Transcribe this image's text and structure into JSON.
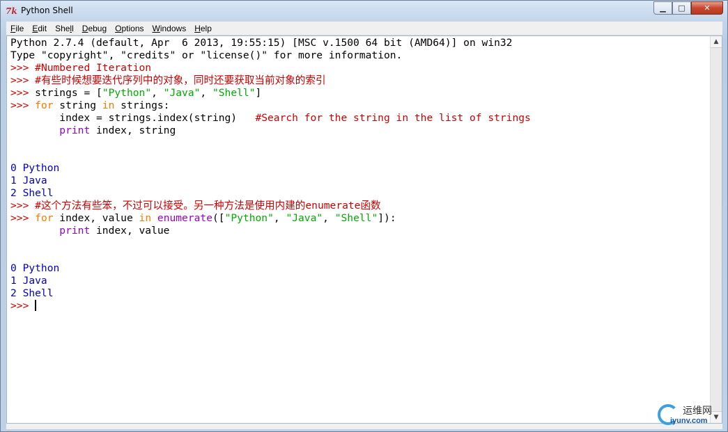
{
  "window": {
    "title": "Python Shell",
    "app_icon_text": "7k",
    "minimize_glyph": "▁",
    "maximize_glyph": "□",
    "close_glyph": "✕"
  },
  "menu": [
    {
      "label": "File",
      "ul": "F",
      "rest": "ile"
    },
    {
      "label": "Edit",
      "ul": "E",
      "rest": "dit"
    },
    {
      "label": "Shell",
      "pre": "She",
      "ul": "l",
      "rest": "l"
    },
    {
      "label": "Debug",
      "ul": "D",
      "rest": "ebug"
    },
    {
      "label": "Options",
      "ul": "O",
      "rest": "ptions"
    },
    {
      "label": "Windows",
      "ul": "W",
      "rest": "indows"
    },
    {
      "label": "Help",
      "ul": "H",
      "rest": "elp"
    }
  ],
  "lines": [
    [
      [
        "blk",
        "Python 2.7.4 (default, Apr  6 2013, 19:55:15) [MSC v.1500 64 bit (AMD64)] on win32"
      ]
    ],
    [
      [
        "blk",
        "Type \"copyright\", \"credits\" or \"license()\" for more information."
      ]
    ],
    [
      [
        "red",
        ">>> "
      ],
      [
        "red",
        "#Numbered Iteration"
      ]
    ],
    [
      [
        "red",
        ">>> "
      ],
      [
        "red",
        "#有些时候想要迭代序列中的对象，同时还要获取当前对象的索引"
      ]
    ],
    [
      [
        "red",
        ">>> "
      ],
      [
        "blk",
        "strings = ["
      ],
      [
        "green",
        "\"Python\""
      ],
      [
        "blk",
        ", "
      ],
      [
        "green",
        "\"Java\""
      ],
      [
        "blk",
        ", "
      ],
      [
        "green",
        "\"Shell\""
      ],
      [
        "blk",
        "]"
      ]
    ],
    [
      [
        "red",
        ">>> "
      ],
      [
        "orange",
        "for"
      ],
      [
        "blk",
        " string "
      ],
      [
        "orange",
        "in"
      ],
      [
        "blk",
        " strings:"
      ]
    ],
    [
      [
        "blk",
        "        index = strings.index(string)   "
      ],
      [
        "red",
        "#Search for the string in the list of strings"
      ]
    ],
    [
      [
        "blk",
        "        "
      ],
      [
        "purple",
        "print"
      ],
      [
        "blk",
        " index, string"
      ]
    ],
    [
      [
        "blk",
        ""
      ]
    ],
    [
      [
        "blk",
        ""
      ]
    ],
    [
      [
        "blue",
        "0 Python"
      ]
    ],
    [
      [
        "blue",
        "1 Java"
      ]
    ],
    [
      [
        "blue",
        "2 Shell"
      ]
    ],
    [
      [
        "red",
        ">>> "
      ],
      [
        "red",
        "#这个方法有些笨，不过可以接受。另一种方法是使用内建的enumerate函数"
      ]
    ],
    [
      [
        "red",
        ">>> "
      ],
      [
        "orange",
        "for"
      ],
      [
        "blk",
        " index, value "
      ],
      [
        "orange",
        "in"
      ],
      [
        "blk",
        " "
      ],
      [
        "purple",
        "enumerate"
      ],
      [
        "blk",
        "(["
      ],
      [
        "green",
        "\"Python\""
      ],
      [
        "blk",
        ", "
      ],
      [
        "green",
        "\"Java\""
      ],
      [
        "blk",
        ", "
      ],
      [
        "green",
        "\"Shell\""
      ],
      [
        "blk",
        "]):"
      ]
    ],
    [
      [
        "blk",
        "        "
      ],
      [
        "purple",
        "print"
      ],
      [
        "blk",
        " index, value"
      ]
    ],
    [
      [
        "blk",
        ""
      ]
    ],
    [
      [
        "blk",
        ""
      ]
    ],
    [
      [
        "blue",
        "0 Python"
      ]
    ],
    [
      [
        "blue",
        "1 Java"
      ]
    ],
    [
      [
        "blue",
        "2 Shell"
      ]
    ],
    [
      [
        "red",
        ">>> "
      ],
      [
        "cursor",
        ""
      ]
    ]
  ],
  "scrollbar": {
    "up_glyph": "▲",
    "down_glyph": "▼"
  },
  "watermark": {
    "cn": "运维网",
    "en": "iyunv.com"
  },
  "colors": {
    "prompt": "#d00000",
    "comment": "#d00000",
    "keyword": "#ff7700",
    "string": "#00aa00",
    "builtin": "#9900cc",
    "output": "#0000cc"
  }
}
